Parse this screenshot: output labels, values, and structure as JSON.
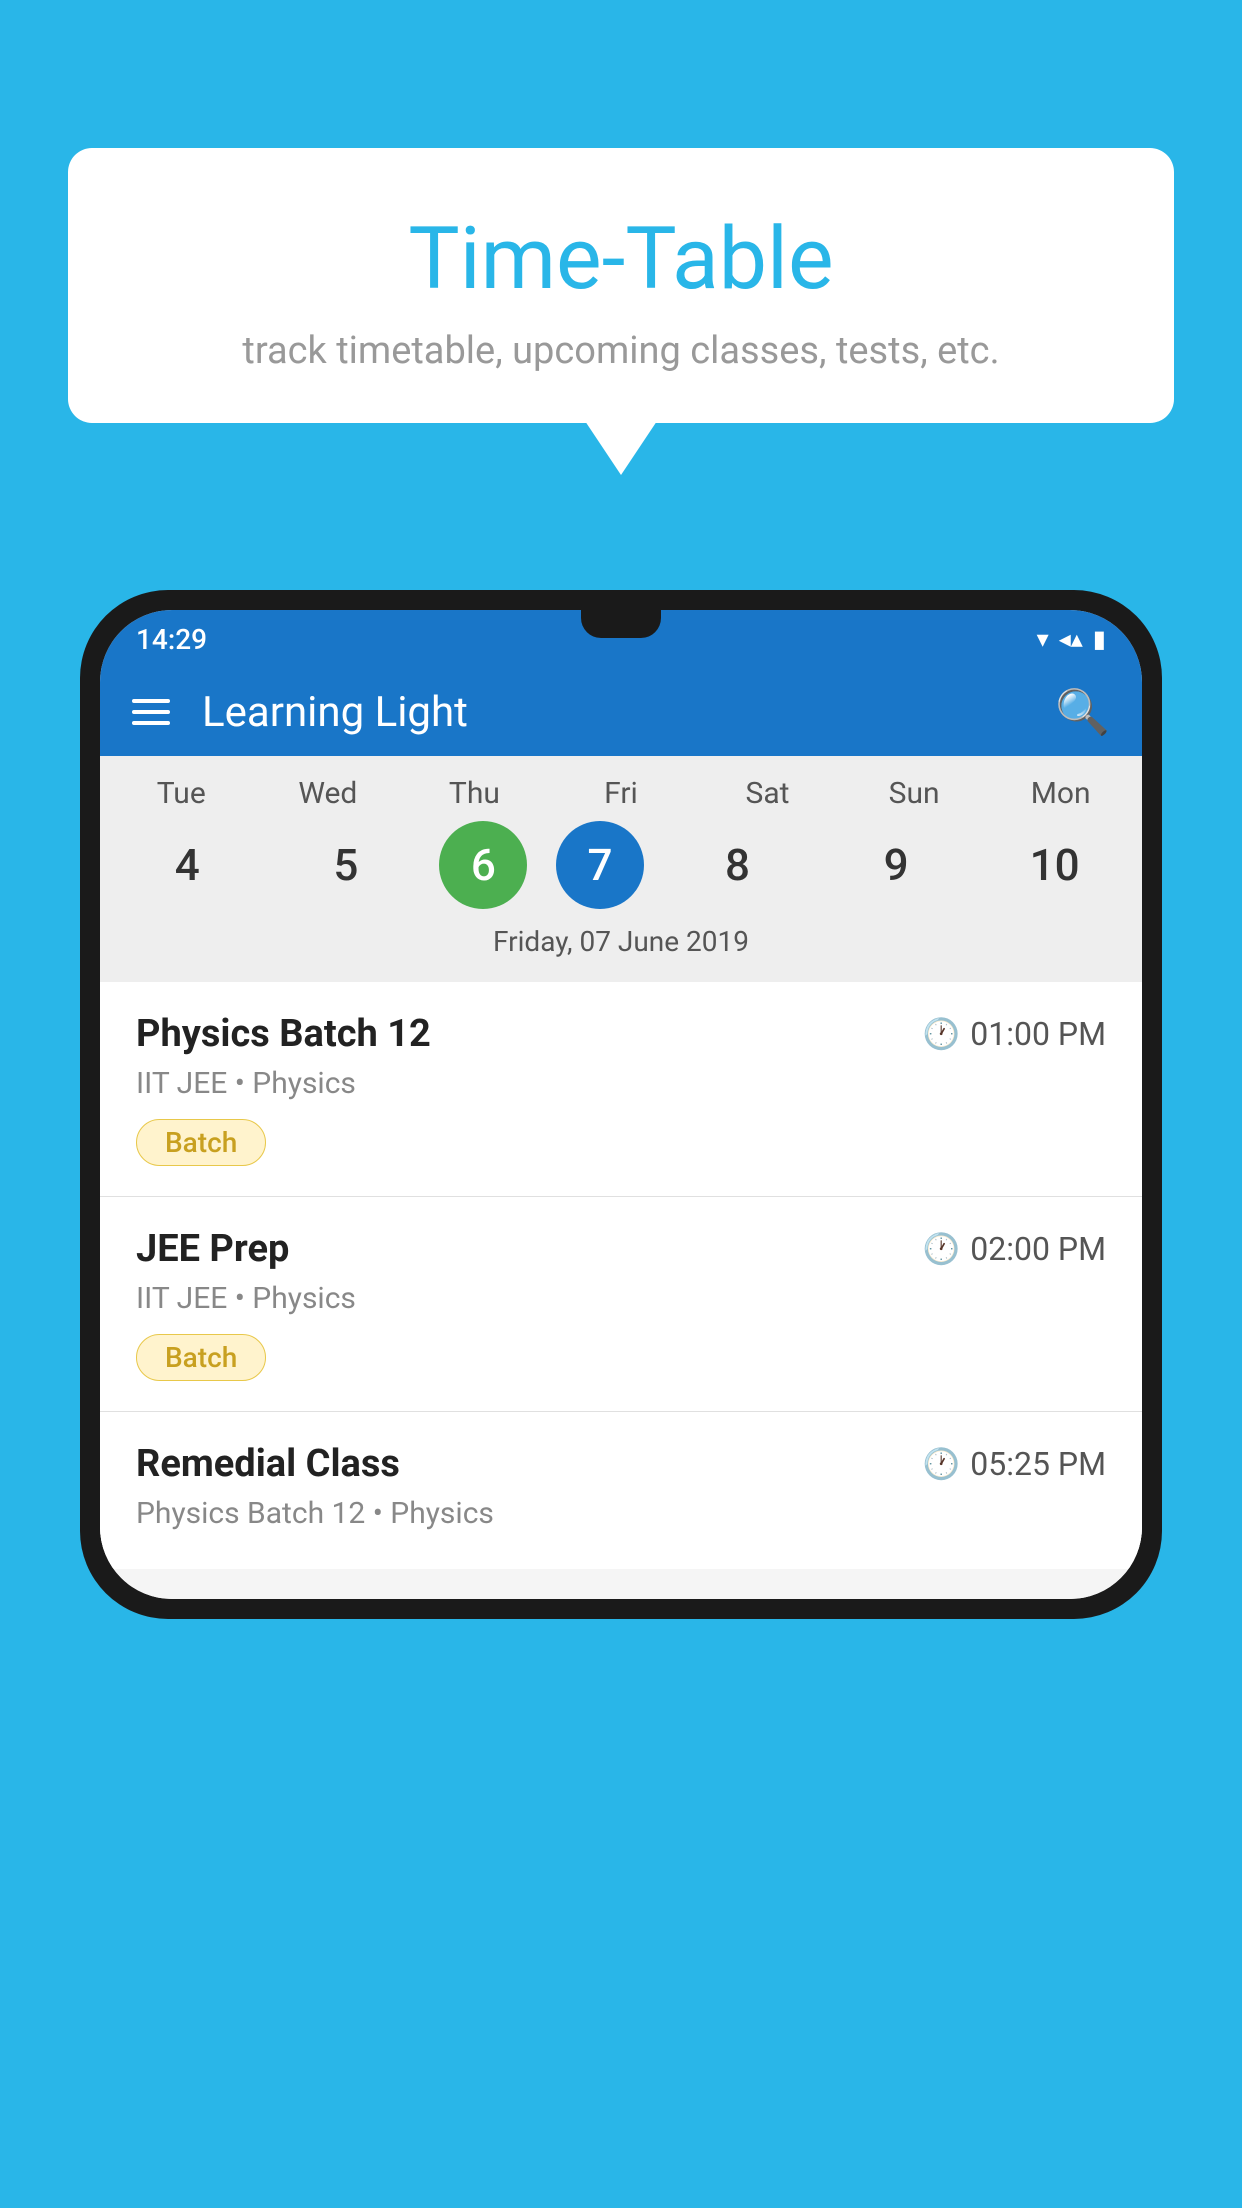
{
  "background_color": "#29b6e8",
  "speech_bubble": {
    "title": "Time-Table",
    "subtitle": "track timetable, upcoming classes, tests, etc."
  },
  "status_bar": {
    "time": "14:29",
    "wifi": "▾",
    "signal": "◂",
    "battery": "▮"
  },
  "app_bar": {
    "title": "Learning Light",
    "menu_icon": "hamburger",
    "search_icon": "search"
  },
  "calendar": {
    "days": [
      {
        "label": "Tue",
        "number": "4",
        "state": "normal"
      },
      {
        "label": "Wed",
        "number": "5",
        "state": "normal"
      },
      {
        "label": "Thu",
        "number": "6",
        "state": "today"
      },
      {
        "label": "Fri",
        "number": "7",
        "state": "selected"
      },
      {
        "label": "Sat",
        "number": "8",
        "state": "normal"
      },
      {
        "label": "Sun",
        "number": "9",
        "state": "normal"
      },
      {
        "label": "Mon",
        "number": "10",
        "state": "normal"
      }
    ],
    "selected_date_label": "Friday, 07 June 2019"
  },
  "classes": [
    {
      "name": "Physics Batch 12",
      "time": "01:00 PM",
      "meta": "IIT JEE • Physics",
      "badge": "Batch"
    },
    {
      "name": "JEE Prep",
      "time": "02:00 PM",
      "meta": "IIT JEE • Physics",
      "badge": "Batch"
    },
    {
      "name": "Remedial Class",
      "time": "05:25 PM",
      "meta": "Physics Batch 12 • Physics",
      "badge": null
    }
  ]
}
